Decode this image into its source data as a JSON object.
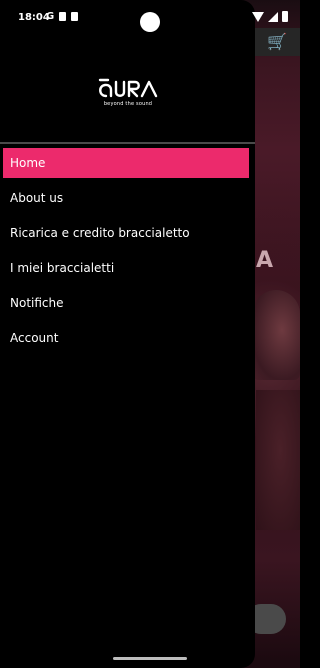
{
  "status_bar": {
    "time": "18:04",
    "carrier_glyph": "G"
  },
  "background_app": {
    "visible_letter": "A",
    "cart_icon": "shopping-cart-icon"
  },
  "drawer": {
    "logo_text": "AURA",
    "logo_tagline": "beyond the sound",
    "menu_items": [
      {
        "label": "Home",
        "active": true
      },
      {
        "label": "About us",
        "active": false
      },
      {
        "label": "Ricarica e credito braccialetto",
        "active": false
      },
      {
        "label": "I miei braccialetti",
        "active": false
      },
      {
        "label": "Notifiche",
        "active": false
      },
      {
        "label": "Account",
        "active": false
      }
    ]
  },
  "colors": {
    "accent": "#ec2a6c",
    "drawer_bg": "#000000",
    "divider": "#4a4a4a",
    "text": "#ffffff"
  }
}
